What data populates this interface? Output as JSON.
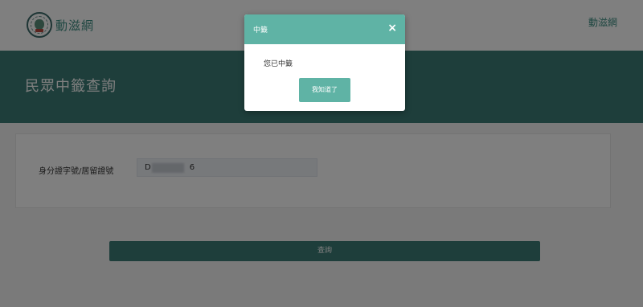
{
  "header": {
    "site_name": "動滋網",
    "nav_link": "動滋網",
    "logo_icon": "ministry-seal-icon"
  },
  "hero": {
    "title": "民眾中籤查詢"
  },
  "form": {
    "id_label": "身分證字號/居留證號",
    "id_value_prefix": "D",
    "id_value_suffix": "6",
    "search_label": "查詢"
  },
  "modal": {
    "title": "中籤",
    "close_icon": "close-icon",
    "message": "您已中籤",
    "confirm_label": "我知道了"
  },
  "colors": {
    "primary": "#3d7d76",
    "modal_accent": "#5fb3a5",
    "link": "#3f8f84",
    "overlay": "rgba(0,0,0,0.5)"
  }
}
